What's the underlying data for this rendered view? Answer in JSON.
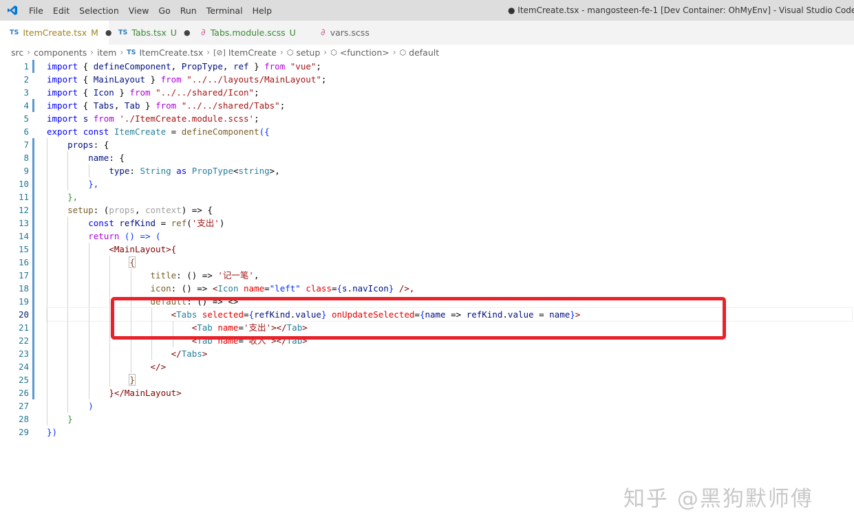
{
  "titlebar": {
    "menu": [
      "File",
      "Edit",
      "Selection",
      "View",
      "Go",
      "Run",
      "Terminal",
      "Help"
    ],
    "window_title": "● ItemCreate.tsx - mangosteen-fe-1 [Dev Container: OhMyEnv] - Visual Studio Code"
  },
  "tabs": [
    {
      "icon": "TS",
      "label": "ItemCreate.tsx",
      "status": "M",
      "dirty": "●",
      "color": "#a1821b"
    },
    {
      "icon": "TS",
      "label": "Tabs.tsx",
      "status": "U",
      "dirty": "●",
      "color": "#388a34"
    },
    {
      "icon": "scss",
      "label": "Tabs.module.scss",
      "status": "U",
      "color": "#388a34"
    },
    {
      "icon": "scss",
      "label": "vars.scss",
      "color": "#616161"
    }
  ],
  "breadcrumb": [
    "src",
    "components",
    "item",
    "ItemCreate.tsx",
    "ItemCreate",
    "setup",
    "<function>",
    "default"
  ],
  "line_numbers": [
    "1",
    "2",
    "3",
    "4",
    "5",
    "6",
    "7",
    "8",
    "9",
    "10",
    "11",
    "12",
    "13",
    "14",
    "15",
    "16",
    "17",
    "18",
    "19",
    "20",
    "21",
    "22",
    "23",
    "24",
    "25",
    "26",
    "27",
    "28",
    "29"
  ],
  "code": {
    "l1": [
      "import",
      " { ",
      "defineComponent",
      ", ",
      "PropType",
      ", ",
      "ref",
      " } ",
      "from",
      " ",
      "\"vue\"",
      ";"
    ],
    "l2": [
      "import",
      " { ",
      "MainLayout",
      " } ",
      "from",
      " ",
      "\"../../layouts/MainLayout\"",
      ";"
    ],
    "l3": [
      "import",
      " { ",
      "Icon",
      " } ",
      "from",
      " ",
      "\"../../shared/Icon\"",
      ";"
    ],
    "l4": [
      "import",
      " { ",
      "Tabs",
      ", ",
      "Tab",
      " } ",
      "from",
      " ",
      "\"../../shared/Tabs\"",
      ";"
    ],
    "l5": [
      "import",
      " ",
      "s",
      " ",
      "from",
      " ",
      "'./ItemCreate.module.scss'",
      ";"
    ],
    "l6": [
      "export",
      " ",
      "const",
      " ",
      "ItemCreate",
      " = ",
      "defineComponent",
      "({"
    ],
    "l7": [
      "props",
      ": {"
    ],
    "l8": [
      "name",
      ": {"
    ],
    "l9": [
      "type",
      ": ",
      "String",
      " ",
      "as",
      " ",
      "PropType",
      "<",
      "string",
      ">,"
    ],
    "l10": [
      "},"
    ],
    "l11": [
      "},"
    ],
    "l12": [
      "setup",
      ": (",
      "props",
      ", ",
      "context",
      ") => {"
    ],
    "l13": [
      "const",
      " ",
      "refKind",
      " = ",
      "ref",
      "(",
      "'支出'",
      ")"
    ],
    "l14": [
      "return",
      " () => ("
    ],
    "l15": [
      "<",
      "MainLayout",
      ">{"
    ],
    "l16": [
      "{"
    ],
    "l17": [
      "title",
      ": () => ",
      "'记一笔'",
      ","
    ],
    "l18": [
      "icon",
      ": () => ",
      "<",
      "Icon",
      " ",
      "name",
      "=",
      "\"left\"",
      " ",
      "class",
      "=",
      "{",
      "s",
      ".",
      "navIcon",
      "}",
      " />,"
    ],
    "l19": [
      "default",
      ": () => <>"
    ],
    "l20": [
      "<",
      "Tabs",
      " ",
      "selected",
      "=",
      "{",
      "refKind",
      ".",
      "value",
      "}",
      " ",
      "onUpdateSelected",
      "=",
      "{",
      "name",
      " => ",
      "refKind",
      ".",
      "value",
      " = ",
      "name",
      "}",
      ">"
    ],
    "l21": [
      "<",
      "Tab",
      " ",
      "name",
      "=",
      "'支出'",
      "></",
      "Tab",
      ">"
    ],
    "l22": [
      "<",
      "Tab",
      " ",
      "name",
      "=",
      "'收入'",
      "></",
      "Tab",
      ">"
    ],
    "l23": [
      "</",
      "Tabs",
      ">"
    ],
    "l24": [
      "</>"
    ],
    "l25": [
      "}"
    ],
    "l26": [
      "}</",
      "MainLayout",
      ">"
    ],
    "l27": [
      ")"
    ],
    "l28": [
      "}"
    ],
    "l29": [
      "})"
    ]
  },
  "watermark": "知乎 @黑狗默师傅",
  "colors": {
    "highlight_box": "#e8212a",
    "line_number": "#237893",
    "modified_bar": "#5899d0"
  }
}
